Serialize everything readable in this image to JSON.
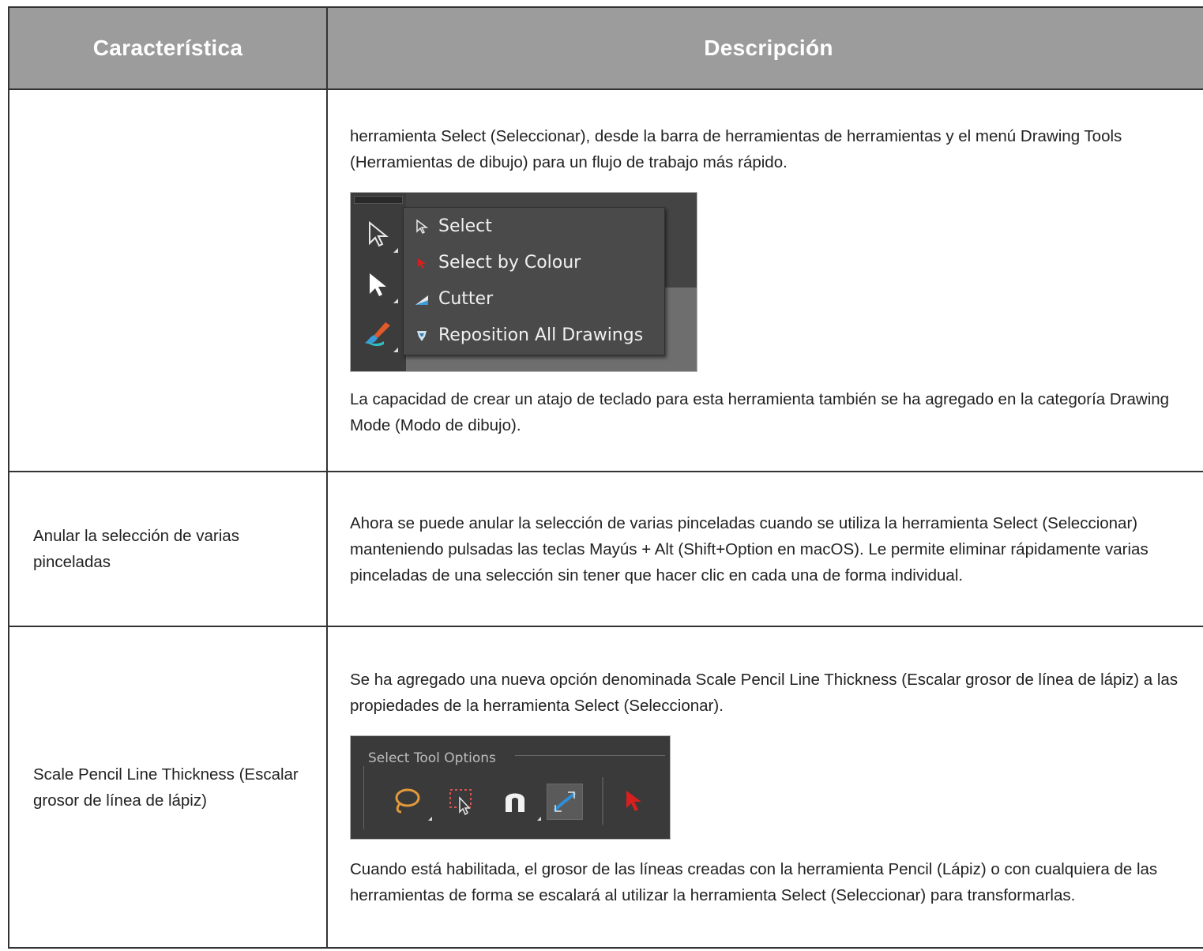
{
  "table": {
    "headers": [
      "Característica",
      "Descripción"
    ],
    "rows": [
      {
        "feature": "",
        "desc_before": "herramienta Select (Seleccionar), desde la barra de herramientas de herramientas y el menú Drawing Tools (Herramientas de dibujo) para un flujo de trabajo más rápido.",
        "desc_after": "La capacidad de crear un atajo de teclado para esta herramienta también se ha agregado en la categoría Drawing Mode (Modo de dibujo)."
      },
      {
        "feature": "Anular la selección de varias pinceladas",
        "desc": "Ahora se puede anular la selección de varias pinceladas cuando se utiliza la herramienta Select (Seleccionar) manteniendo pulsadas las teclas Mayús + Alt (Shift+Option en macOS). Le permite eliminar rápidamente varias pinceladas de una selección sin tener que hacer clic en cada una de forma individual."
      },
      {
        "feature": "Scale Pencil Line Thickness (Escalar grosor de línea de lápiz)",
        "desc_before": "Se ha agregado una nueva opción denominada Scale Pencil Line Thickness (Escalar grosor de línea de lápiz) a las propiedades de la herramienta Select (Seleccionar).",
        "desc_after": "Cuando está habilitada, el grosor de las líneas creadas con la herramienta Pencil (Lápiz) o con cualquiera de las herramientas de forma se escalará al utilizar la herramienta Select (Seleccionar) para transformarlas."
      }
    ]
  },
  "tool_menu": {
    "items": [
      {
        "label": "Select",
        "icon": "arrow-outline-icon"
      },
      {
        "label": "Select by Colour",
        "icon": "red-arrow-icon"
      },
      {
        "label": "Cutter",
        "icon": "cutter-icon"
      },
      {
        "label": "Reposition All Drawings",
        "icon": "reposition-icon"
      }
    ]
  },
  "select_tool_options": {
    "title": "Select Tool Options",
    "icons": [
      "lasso-icon",
      "marquee-select-icon",
      "snap-magnet-icon",
      "scale-line-thickness-icon",
      "select-by-colour-icon"
    ]
  },
  "colors": {
    "header_bg": "#9c9c9c",
    "border": "#333333",
    "ui_dark": "#3a3a3a"
  }
}
